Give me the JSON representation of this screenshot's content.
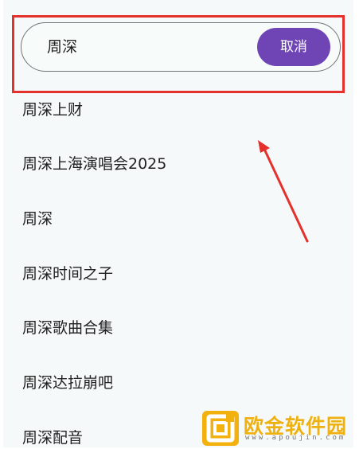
{
  "search": {
    "value": "周深",
    "cancel_label": "取消"
  },
  "suggestions": [
    "周深上财",
    "周深上海演唱会2025",
    "周深",
    "周深时间之子",
    "周深歌曲合集",
    "周深达拉崩吧",
    "周深配音"
  ],
  "watermark": {
    "title": "欧金软件园",
    "url": "www.apoujin.com"
  },
  "colors": {
    "accent": "#6f45b5",
    "annotation": "#e4312b",
    "watermark": "#f2b10d"
  },
  "icons": {
    "annotation_arrow": "red-arrow-icon",
    "watermark_logo": "square-logo-icon"
  }
}
